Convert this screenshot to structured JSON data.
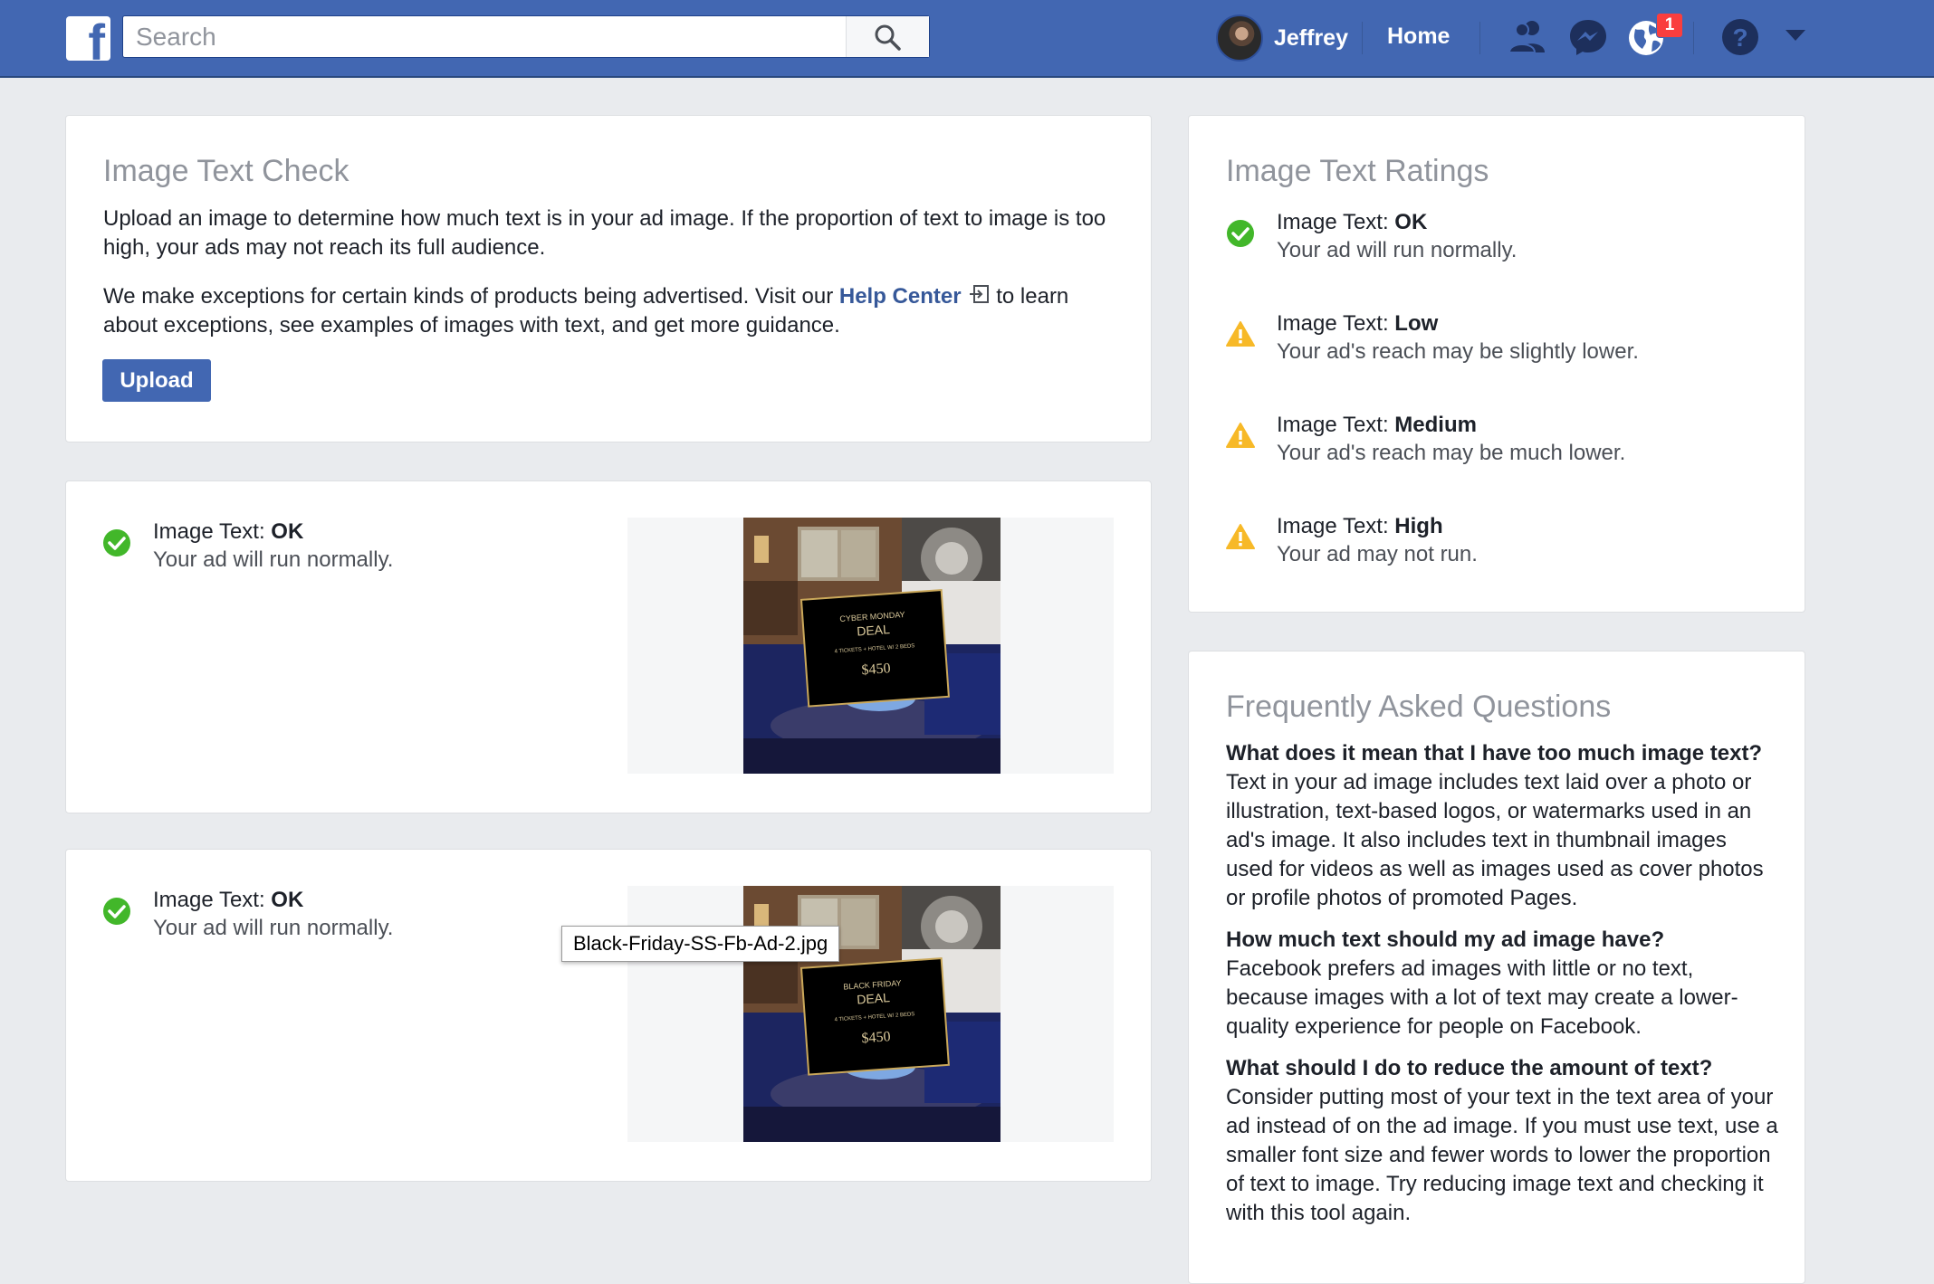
{
  "topbar": {
    "logo_letter": "f",
    "search_placeholder": "Search",
    "profile_name": "Jeffrey",
    "home_label": "Home",
    "notification_count": "1",
    "colors": {
      "bar": "#4267b2",
      "badge": "#fa3e3e"
    }
  },
  "check_card": {
    "title": "Image Text Check",
    "para1": "Upload an image to determine how much text is in your ad image. If the proportion of text to image is too high, your ads may not reach its full audience.",
    "para2_before": "We make exceptions for certain kinds of products being advertised. Visit our ",
    "help_link": "Help Center",
    "para2_after": " to learn about exceptions, see examples of images with text, and get more guidance.",
    "upload_label": "Upload"
  },
  "results": [
    {
      "label": "Image Text: ",
      "value": "OK",
      "sub": "Your ad will run normally.",
      "ad": {
        "line1": "CYBER MONDAY",
        "line2": "DEAL",
        "line3": "4 TICKETS + HOTEL W/ 2 BEDS",
        "price": "$450"
      }
    },
    {
      "label": "Image Text: ",
      "value": "OK",
      "sub": "Your ad will run normally.",
      "ad": {
        "line1": "BLACK FRIDAY",
        "line2": "DEAL",
        "line3": "4 TICKETS + HOTEL W/ 2 BEDS",
        "price": "$450"
      },
      "tooltip": "Black-Friday-SS-Fb-Ad-2.jpg"
    }
  ],
  "ratings_card": {
    "title": "Image Text Ratings",
    "items": [
      {
        "label": "Image Text: ",
        "value": "OK",
        "sub": "Your ad will run normally.",
        "icon": "check-circle-icon"
      },
      {
        "label": "Image Text: ",
        "value": "Low",
        "sub": "Your ad's reach may be slightly lower.",
        "icon": "warning-icon"
      },
      {
        "label": "Image Text: ",
        "value": "Medium",
        "sub": "Your ad's reach may be much lower.",
        "icon": "warning-icon"
      },
      {
        "label": "Image Text: ",
        "value": "High",
        "sub": "Your ad may not run.",
        "icon": "warning-icon"
      }
    ],
    "colors": {
      "ok": "#42b72a",
      "warning": "#f7b928"
    }
  },
  "faq_card": {
    "title": "Frequently Asked Questions",
    "items": [
      {
        "q": "What does it mean that I have too much image text?",
        "a": "Text in your ad image includes text laid over a photo or illustration, text-based logos, or watermarks used in an ad's image. It also includes text in thumbnail images used for videos as well as images used as cover photos or profile photos of promoted Pages."
      },
      {
        "q": "How much text should my ad image have?",
        "a": "Facebook prefers ad images with little or no text, because images with a lot of text may create a lower-quality experience for people on Facebook."
      },
      {
        "q": "What should I do to reduce the amount of text?",
        "a": "Consider putting most of your text in the text area of your ad instead of on the ad image. If you must use text, use a smaller font size and fewer words to lower the proportion of text to image. Try reducing image text and checking it with this tool again."
      }
    ]
  }
}
